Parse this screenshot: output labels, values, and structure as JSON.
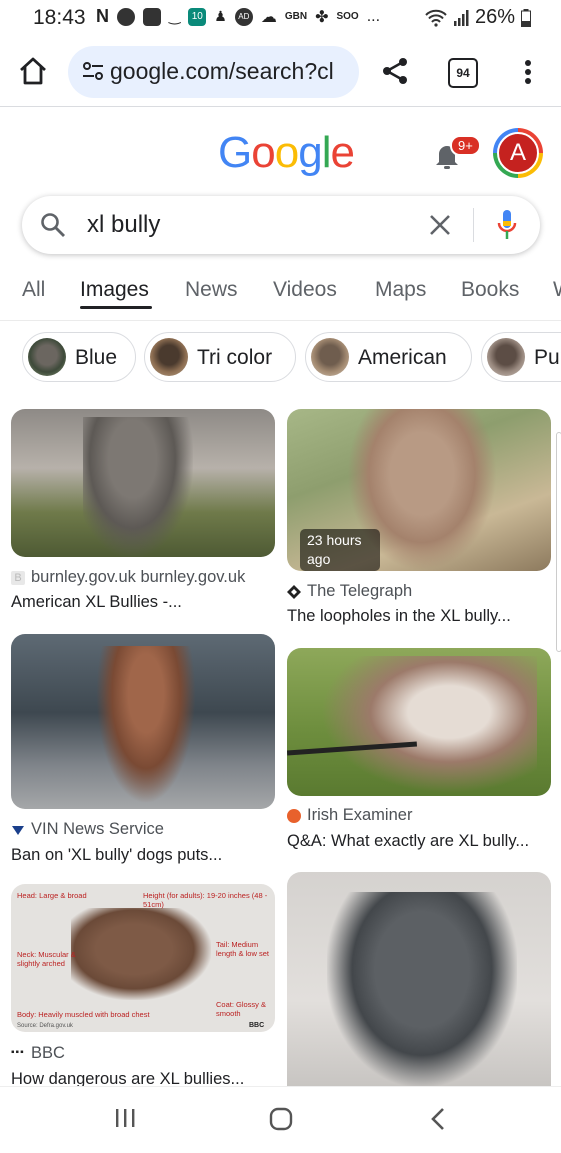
{
  "status_bar": {
    "time": "18:43",
    "icons": [
      "N",
      "messenger-icon",
      "youtube-icon",
      "amazon-icon",
      "10",
      "cat-icon",
      "AD",
      "cloud-icon",
      "GBN",
      "clover-icon",
      "SOO",
      "..."
    ],
    "battery": "26%"
  },
  "browser": {
    "url": "google.com/search?cl",
    "tab_count": "94"
  },
  "header": {
    "logo_letters": [
      "G",
      "o",
      "o",
      "g",
      "l",
      "e"
    ],
    "logo_colors": [
      "#4285f4",
      "#ea4335",
      "#fbbc05",
      "#4285f4",
      "#34a853",
      "#ea4335"
    ],
    "notification_badge": "9+",
    "avatar_letter": "A"
  },
  "search": {
    "query": "xl bully"
  },
  "nav_tabs": [
    "All",
    "Images",
    "News",
    "Videos",
    "Maps",
    "Books",
    "W"
  ],
  "active_tab": "Images",
  "chips": [
    "Blue",
    "Tri color",
    "American",
    "Puppy"
  ],
  "results": {
    "left": [
      {
        "source": "burnley.gov.uk burnley.gov.uk",
        "title": "American XL Bullies -..."
      },
      {
        "source": "VIN News Service",
        "title": "Ban on 'XL bully' dogs puts..."
      },
      {
        "source": "BBC",
        "title": "How dangerous are XL bullies..."
      }
    ],
    "right": [
      {
        "timestamp": "23 hours ago",
        "source": "The Telegraph",
        "title": "The loopholes in the XL bully..."
      },
      {
        "source": "Irish Examiner",
        "title": "Q&A: What exactly are XL bully..."
      }
    ],
    "infographic": {
      "head": "Head: Large & broad",
      "height": "Height (for adults): 19-20 inches (48 - 51cm)",
      "tail": "Tail: Medium length & low set",
      "neck": "Neck: Muscular & slightly arched",
      "coat": "Coat: Glossy & smooth",
      "body": "Body: Heavily muscled with broad chest",
      "credit": "Source: Defra.gov.uk",
      "logo": "BBC"
    }
  }
}
